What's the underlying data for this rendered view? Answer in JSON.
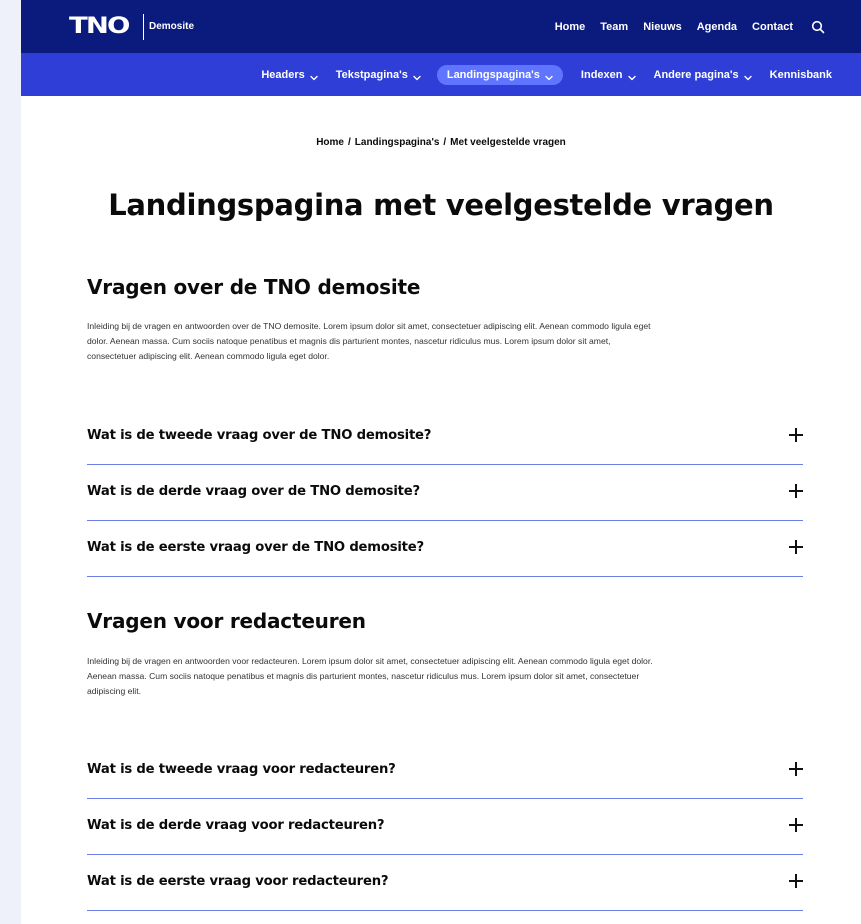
{
  "header": {
    "logo_text": "TNO",
    "site_name": "Demosite",
    "nav": [
      "Home",
      "Team",
      "Nieuws",
      "Agenda",
      "Contact"
    ],
    "search_icon": "search-icon",
    "colors": {
      "topbar": "#0a1a7d",
      "subnav": "#2f3ed6",
      "active_pill": "#5f74ff"
    }
  },
  "subnav": {
    "items": [
      {
        "label": "Headers",
        "dropdown": true
      },
      {
        "label": "Tekstpagina's",
        "dropdown": true
      },
      {
        "label": "Landingspagina's",
        "dropdown": true,
        "active": true
      },
      {
        "label": "Indexen",
        "dropdown": true
      },
      {
        "label": "Andere pagina's",
        "dropdown": true
      },
      {
        "label": "Kennisbank",
        "dropdown": false
      }
    ]
  },
  "breadcrumb": [
    "Home",
    "Landingspagina's",
    "Met veelgestelde vragen"
  ],
  "page_title": "Landingspagina met veelgestelde vragen",
  "sections": [
    {
      "title": "Vragen over de TNO demosite",
      "intro_lines": [
        "Inleiding bij de vragen en antwoorden over de TNO demosite. Lorem ipsum dolor sit amet, consectetuer adipiscing elit. Aenean commodo ligula eget",
        "dolor. Aenean massa. Cum sociis natoque penatibus et magnis dis parturient montes, nascetur ridiculus mus. Lorem ipsum dolor sit amet,",
        "consectetuer adipiscing elit. Aenean commodo ligula eget dolor."
      ],
      "questions": [
        "Wat is de tweede vraag over de TNO demosite?",
        "Wat is de derde vraag over de TNO demosite?",
        "Wat is de eerste vraag over de TNO demosite?"
      ]
    },
    {
      "title": "Vragen voor redacteuren",
      "intro_lines": [
        "Inleiding bij de vragen en antwoorden voor redacteuren. Lorem ipsum dolor sit amet, consectetuer adipiscing elit. Aenean commodo ligula eget dolor.",
        "Aenean massa. Cum sociis natoque penatibus et magnis dis parturient montes, nascetur ridiculus mus. Lorem ipsum dolor sit amet, consectetuer",
        "adipiscing elit."
      ],
      "questions": [
        "Wat is de tweede vraag voor redacteuren?",
        "Wat is de derde vraag voor redacteuren?",
        "Wat is de eerste vraag voor redacteuren?"
      ]
    }
  ]
}
